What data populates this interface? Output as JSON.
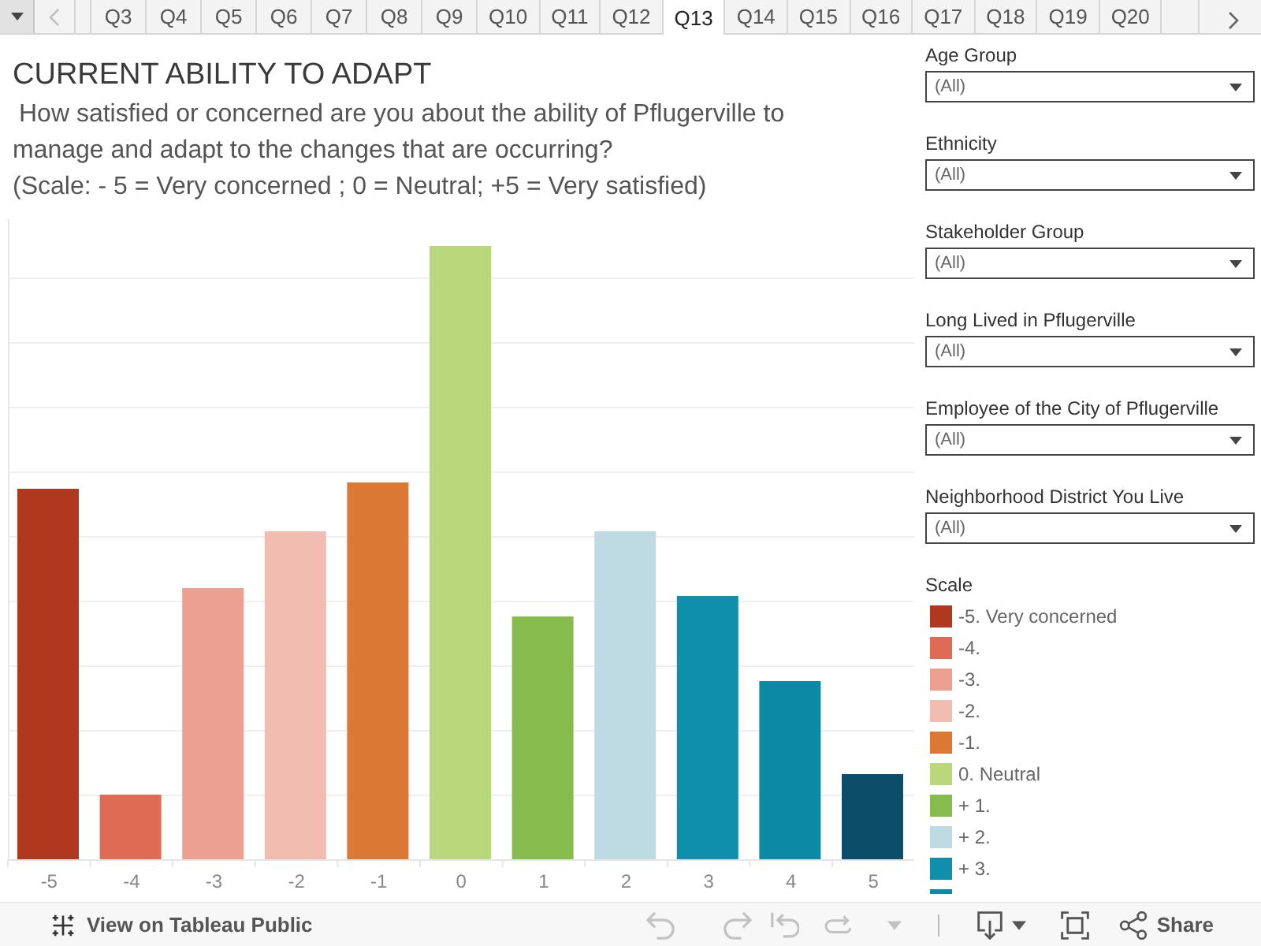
{
  "tab_bar": {
    "tabs": [
      {
        "label": "Q3",
        "selected": false
      },
      {
        "label": "Q4",
        "selected": false
      },
      {
        "label": "Q5",
        "selected": false
      },
      {
        "label": "Q6",
        "selected": false
      },
      {
        "label": "Q7",
        "selected": false
      },
      {
        "label": "Q8",
        "selected": false
      },
      {
        "label": "Q9",
        "selected": false
      },
      {
        "label": "Q10",
        "selected": false
      },
      {
        "label": "Q11",
        "selected": false
      },
      {
        "label": "Q12",
        "selected": false
      },
      {
        "label": "Q13",
        "selected": true
      },
      {
        "label": "Q14",
        "selected": false
      },
      {
        "label": "Q15",
        "selected": false
      },
      {
        "label": "Q16",
        "selected": false
      },
      {
        "label": "Q17",
        "selected": false
      },
      {
        "label": "Q18",
        "selected": false
      },
      {
        "label": "Q19",
        "selected": false
      },
      {
        "label": "Q20",
        "selected": false
      }
    ]
  },
  "title": "CURRENT ABILITY TO ADAPT",
  "question": "How satisfied or concerned are you about the ability of Pflugerville to manage and adapt to the changes that are occurring?",
  "scale_note": "(Scale: - 5 = Very concerned ; 0 = Neutral; +5 = Very satisfied)",
  "chart": {
    "bars": [
      {
        "label": "-5",
        "color": "#b0381e"
      },
      {
        "label": "-4",
        "color": "#e06b55"
      },
      {
        "label": "-3",
        "color": "#eba092"
      },
      {
        "label": "-2",
        "color": "#f1bdb1"
      },
      {
        "label": "-1",
        "color": "#da7834"
      },
      {
        "label": "0",
        "color": "#b9d87c"
      },
      {
        "label": "1",
        "color": "#85bc4d"
      },
      {
        "label": "2",
        "color": "#bedbe3"
      },
      {
        "label": "3",
        "color": "#0f8fab"
      },
      {
        "label": "4",
        "color": "#0c8aa5"
      },
      {
        "label": "5",
        "color": "#0c4d6a"
      }
    ]
  },
  "filters": [
    {
      "label": "Age Group",
      "value": "(All)"
    },
    {
      "label": "Ethnicity",
      "value": "(All)"
    },
    {
      "label": "Stakeholder Group",
      "value": "(All)"
    },
    {
      "label": "Long Lived in Pflugerville",
      "value": "(All)"
    },
    {
      "label": "Employee of the City of Pflugerville",
      "value": "(All)"
    },
    {
      "label": "Neighborhood District You Live",
      "value": "(All)"
    }
  ],
  "legend": {
    "title": "Scale",
    "items": [
      {
        "label": "-5. Very concerned",
        "color": "#b0381e"
      },
      {
        "label": "-4.",
        "color": "#e06b55"
      },
      {
        "label": "-3.",
        "color": "#eba092"
      },
      {
        "label": "-2.",
        "color": "#f1bdb1"
      },
      {
        "label": "-1.",
        "color": "#da7834"
      },
      {
        "label": "0. Neutral",
        "color": "#b9d87c"
      },
      {
        "label": "+ 1.",
        "color": "#85bc4d"
      },
      {
        "label": "+ 2.",
        "color": "#bedbe3"
      },
      {
        "label": "+ 3.",
        "color": "#0f8fab"
      },
      {
        "color": "#0c8aa5"
      }
    ]
  },
  "toolbar": {
    "link": "View on Tableau Public",
    "buttons": [
      {
        "kind": "undo",
        "disabled": true
      },
      {
        "kind": "redo",
        "disabled": true
      },
      {
        "kind": "revert",
        "disabled": true
      },
      {
        "kind": "refresh",
        "disabled": true
      },
      {
        "kind": "menu",
        "disabled": true
      },
      {
        "kind": "download",
        "disabled": false
      },
      {
        "kind": "fullscreen",
        "disabled": false
      }
    ],
    "share": "Share"
  }
}
